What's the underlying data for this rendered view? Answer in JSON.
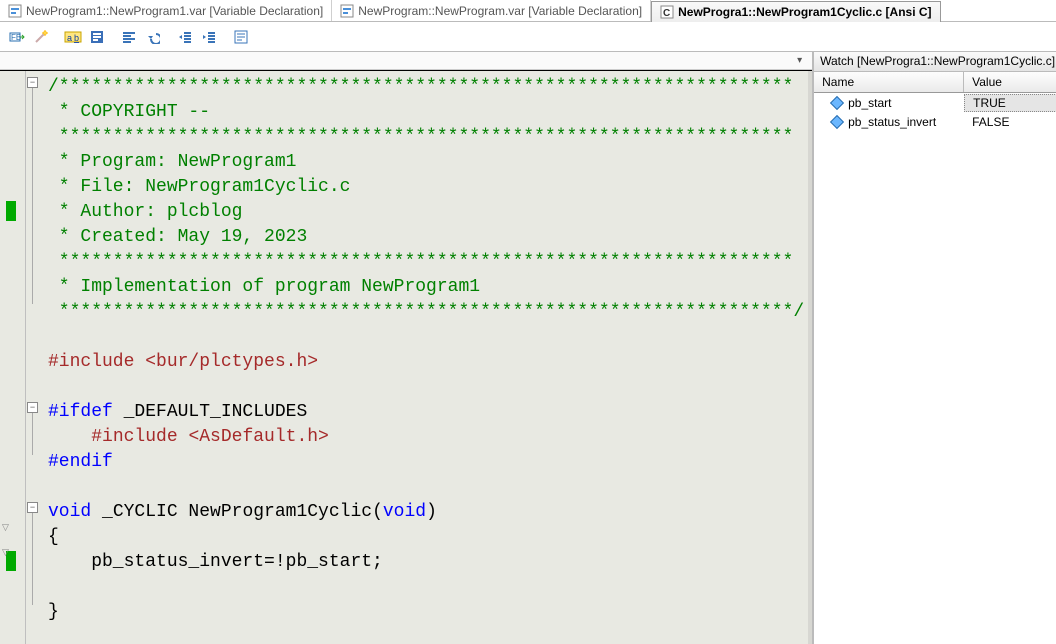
{
  "tabs": [
    {
      "icon_name": "var-file-icon",
      "label": "NewProgram1::NewProgram1.var [Variable Declaration]",
      "active": false
    },
    {
      "icon_name": "var-file-icon",
      "label": "NewProgram::NewProgram.var [Variable Declaration]",
      "active": false
    },
    {
      "icon_name": "c-file-icon",
      "label": "NewProgra1::NewProgram1Cyclic.c [Ansi C]",
      "active": true
    }
  ],
  "toolbar": {
    "buttons": [
      "fb-insert-icon",
      "magic-wand-icon",
      "highlight-ab-icon",
      "block-select-icon",
      "align-left-icon",
      "undo-icon",
      "outdent-icon",
      "indent-icon",
      "note-icon"
    ]
  },
  "code": {
    "lines": [
      {
        "cls": "c-comment",
        "text": "/********************************************************************"
      },
      {
        "cls": "c-comment",
        "text": " * COPYRIGHT --"
      },
      {
        "cls": "c-comment",
        "text": " ********************************************************************"
      },
      {
        "cls": "c-comment",
        "text": " * Program: NewProgram1"
      },
      {
        "cls": "c-comment",
        "text": " * File: NewProgram1Cyclic.c"
      },
      {
        "cls": "c-comment",
        "text": " * Author: plcblog"
      },
      {
        "cls": "c-comment",
        "text": " * Created: May 19, 2023"
      },
      {
        "cls": "c-comment",
        "text": " ********************************************************************"
      },
      {
        "cls": "c-comment",
        "text": " * Implementation of program NewProgram1"
      },
      {
        "cls": "c-comment",
        "text": " ********************************************************************/"
      },
      {
        "cls": "",
        "text": ""
      },
      {
        "cls": "mixed",
        "segments": [
          {
            "cls": "c-include",
            "text": "#include "
          },
          {
            "cls": "c-string",
            "text": "<bur/plctypes.h>"
          }
        ]
      },
      {
        "cls": "",
        "text": ""
      },
      {
        "cls": "mixed",
        "segments": [
          {
            "cls": "c-type",
            "text": "#ifdef"
          },
          {
            "cls": "c-ident",
            "text": " _DEFAULT_INCLUDES"
          }
        ]
      },
      {
        "cls": "mixed",
        "segments": [
          {
            "cls": "c-ident",
            "text": "    "
          },
          {
            "cls": "c-include",
            "text": "#include "
          },
          {
            "cls": "c-string",
            "text": "<AsDefault.h>"
          }
        ]
      },
      {
        "cls": "c-type",
        "text": "#endif"
      },
      {
        "cls": "",
        "text": ""
      },
      {
        "cls": "mixed",
        "segments": [
          {
            "cls": "c-type",
            "text": "void"
          },
          {
            "cls": "c-ident",
            "text": " _CYCLIC NewProgram1Cyclic("
          },
          {
            "cls": "c-type",
            "text": "void"
          },
          {
            "cls": "c-ident",
            "text": ")"
          }
        ]
      },
      {
        "cls": "c-ident",
        "text": "{"
      },
      {
        "cls": "c-ident",
        "text": "    pb_status_invert=!pb_start;"
      },
      {
        "cls": "",
        "text": ""
      },
      {
        "cls": "c-ident",
        "text": "}"
      }
    ]
  },
  "watch": {
    "title": "Watch [NewProgra1::NewProgram1Cyclic.c]",
    "columns": {
      "name": "Name",
      "value": "Value"
    },
    "rows": [
      {
        "name": "pb_start",
        "value": "TRUE",
        "selected": true
      },
      {
        "name": "pb_status_invert",
        "value": "FALSE",
        "selected": false
      }
    ]
  }
}
